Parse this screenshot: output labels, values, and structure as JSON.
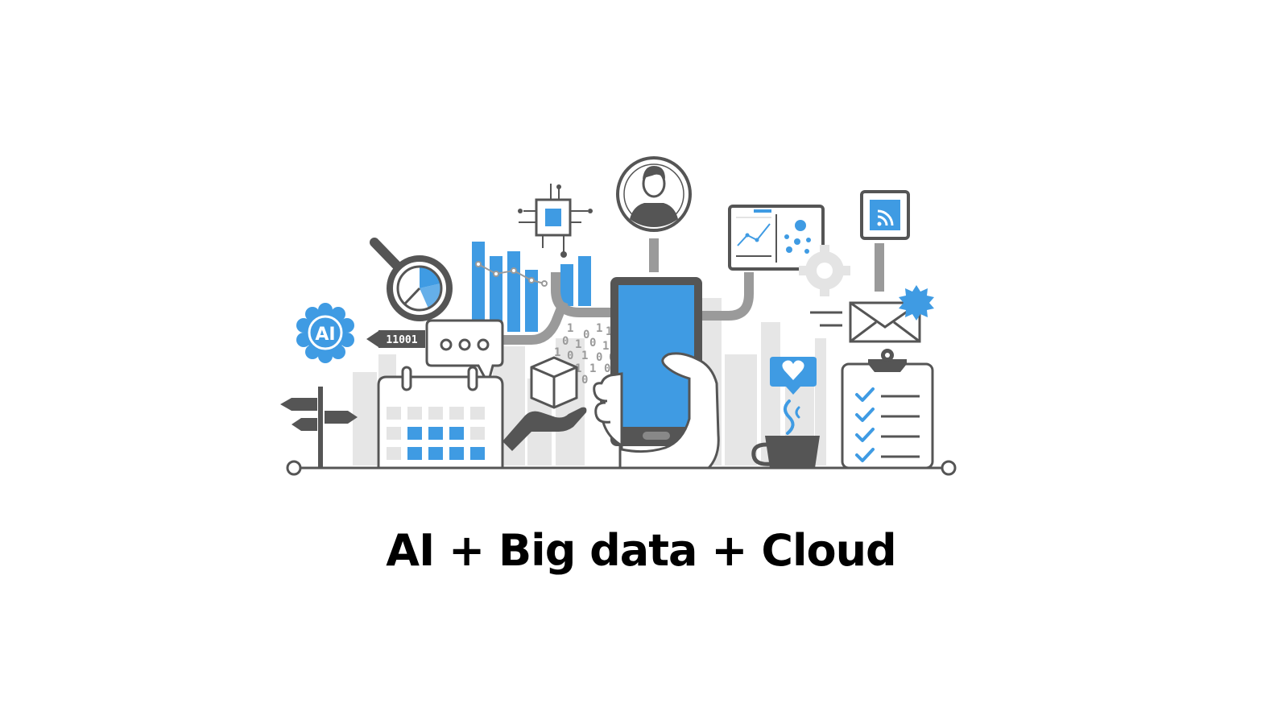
{
  "caption": "AI + Big data + Cloud",
  "ai_badge_text": "AI",
  "binary_arrow_text": "11001",
  "binary_stream": [
    "1",
    "0",
    "1",
    "1",
    "0",
    "1",
    "0",
    "1",
    "1",
    "0",
    "1",
    "0",
    "0",
    "1",
    "0",
    "1",
    "1",
    "0",
    "0"
  ],
  "icons": [
    "ai-brain-icon",
    "magnifier-pie-icon",
    "bar-chart-icon",
    "chip-icon",
    "user-avatar-icon",
    "dashboard-monitor-icon",
    "gear-icon",
    "wifi-tile-icon",
    "envelope-icon",
    "badge-icon",
    "smartphone-icon",
    "hand-icon",
    "calendar-icon",
    "chat-bubble-icon",
    "cube-icon",
    "heart-bubble-icon",
    "coffee-cup-icon",
    "clipboard-checklist-icon",
    "signpost-icon"
  ],
  "colors": {
    "blue": "#3f9be3",
    "dark_gray": "#555555",
    "mid_gray": "#9a9a9a",
    "light_gray": "#e4e4e4",
    "white": "#ffffff"
  }
}
